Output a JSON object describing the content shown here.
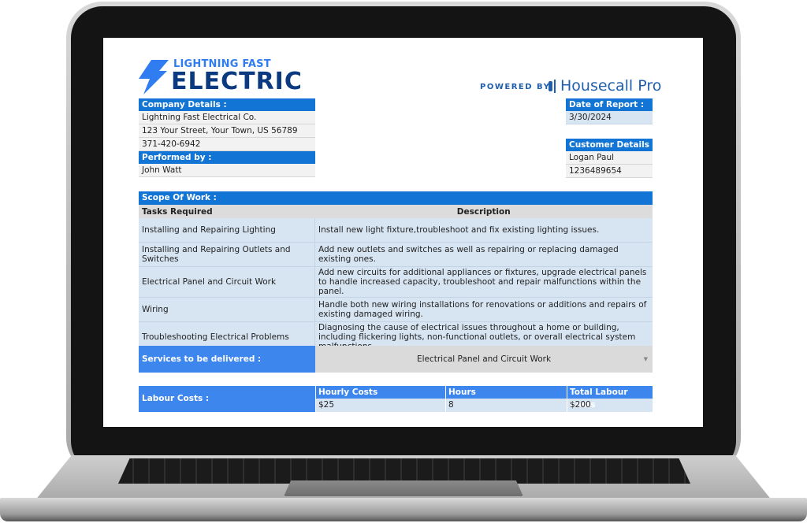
{
  "brand": {
    "logo_top": "LIGHTNING FAST",
    "logo_bottom": "ELECTRIC",
    "powered_by": "POWERED BY",
    "partner_name": "Housecall Pro",
    "accent_color": "#1275d6",
    "logo_dark_color": "#0b3a80"
  },
  "company": {
    "header": "Company Details :",
    "name": "Lightning Fast Electrical Co.",
    "address": "123 Your Street, Your Town, US 56789",
    "phone": "371-420-6942",
    "performed_by_header": "Performed by  :",
    "performed_by": "John Watt"
  },
  "report": {
    "date_header": "Date of Report :",
    "date": "3/30/2024"
  },
  "customer": {
    "header": "Customer Details :",
    "name": "Logan Paul",
    "phone": "1236489654"
  },
  "scope": {
    "header": "Scope Of Work  :",
    "columns": [
      "Tasks Required",
      "Description"
    ],
    "rows": [
      {
        "task": "Installing and Repairing Lighting",
        "description": "Install new light fixture,troubleshoot and fix existing lighting issues."
      },
      {
        "task": "Installing and Repairing Outlets and Switches",
        "description": "Add new outlets and switches as well as repairing or replacing damaged existing ones."
      },
      {
        "task": "Electrical Panel and Circuit Work",
        "description": "Add new circuits for additional appliances or fixtures, upgrade electrical panels to handle increased capacity, troubleshoot and repair malfunctions within the panel."
      },
      {
        "task": "Wiring",
        "description": "Handle both new wiring installations for renovations or additions and repairs of existing damaged wiring."
      },
      {
        "task": "Troubleshooting Electrical Problems",
        "description": "Diagnosing the cause of electrical issues throughout a home or building, including flickering lights, non-functional outlets, or overall electrical system malfunctions."
      }
    ]
  },
  "services": {
    "label": "Services to be delivered :",
    "selected": "Electrical Panel and Circuit Work",
    "caret": "▼"
  },
  "labour": {
    "label": "Labour Costs :",
    "columns": [
      "Hourly Costs",
      "Hours",
      "Total Labour Costs"
    ],
    "values": [
      "$25",
      "8",
      "$200"
    ]
  }
}
